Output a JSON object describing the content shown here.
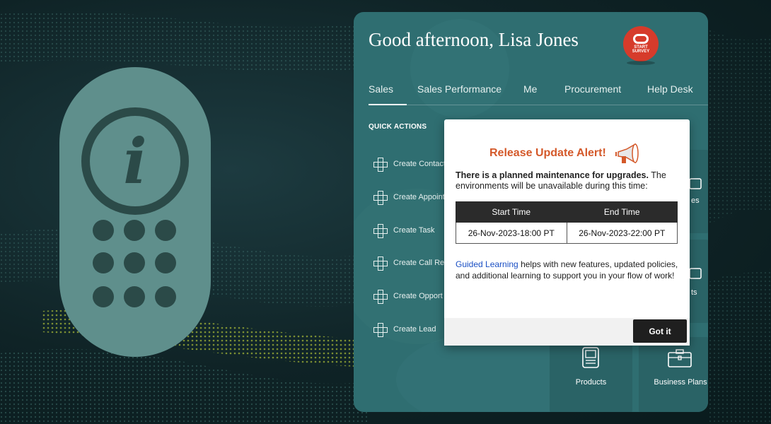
{
  "greeting": "Good afternoon, Lisa Jones",
  "survey": {
    "line1": "START",
    "line2": "SURVEY"
  },
  "tabs": [
    {
      "label": "Sales"
    },
    {
      "label": "Sales Performance"
    },
    {
      "label": "Me"
    },
    {
      "label": "Procurement"
    },
    {
      "label": "Help Desk"
    }
  ],
  "quick_actions": {
    "title": "QUICK ACTIONS",
    "items": [
      {
        "label": "Create Contact"
      },
      {
        "label": "Create Appoint"
      },
      {
        "label": "Create Task"
      },
      {
        "label": "Create Call Rep"
      },
      {
        "label": "Create Opport"
      },
      {
        "label": "Create Lead"
      }
    ]
  },
  "tiles": {
    "partial1": "es",
    "partial2": "ts",
    "products": "Products",
    "business_plans": "Business Plans"
  },
  "popup": {
    "title": "Release Update Alert!",
    "body_bold": "There is a planned maintenance for upgrades.",
    "body_rest": " The environments will be unavailable during this time:",
    "table": {
      "headers": [
        "Start Time",
        "End Time"
      ],
      "row": [
        "26-Nov-2023-18:00 PT",
        "26-Nov-2023-22:00 PT"
      ]
    },
    "info_link": "Guided Learning",
    "info_rest": " helps with new features, updated policies, and additional learning to support you in your flow of work!",
    "button": "Got it"
  },
  "colors": {
    "panel": "#2f6e71",
    "accent": "#d4592a",
    "link": "#1a4fc4",
    "survey": "#d63b2b"
  },
  "icons": [
    "info-remote-icon",
    "plus-icon",
    "megaphone-icon",
    "products-icon",
    "briefcase-icon"
  ]
}
